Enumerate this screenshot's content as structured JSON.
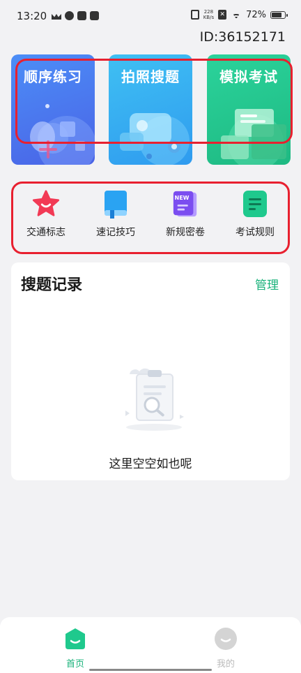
{
  "status_bar": {
    "time": "13:20",
    "speed_value": "228",
    "speed_unit": "KB/s",
    "battery": "72%"
  },
  "user": {
    "id_text": "ID:36152171"
  },
  "feature_cards": [
    {
      "title": "顺序练习",
      "color": "#4a6ee8"
    },
    {
      "title": "拍照搜题",
      "color": "#35adf1"
    },
    {
      "title": "模拟考试",
      "color": "#24c68d"
    }
  ],
  "quick_nav": [
    {
      "label": "交通标志",
      "icon": "star-icon"
    },
    {
      "label": "速记技巧",
      "icon": "book-icon"
    },
    {
      "label": "新规密卷",
      "icon": "new-doc-icon",
      "badge": "NEW"
    },
    {
      "label": "考试规则",
      "icon": "rules-icon"
    }
  ],
  "records": {
    "title": "搜题记录",
    "manage_label": "管理",
    "empty_text": "这里空空如也呢"
  },
  "tab_bar": {
    "home_label": "首页",
    "mine_label": "我的",
    "active_color": "#18b27a"
  }
}
